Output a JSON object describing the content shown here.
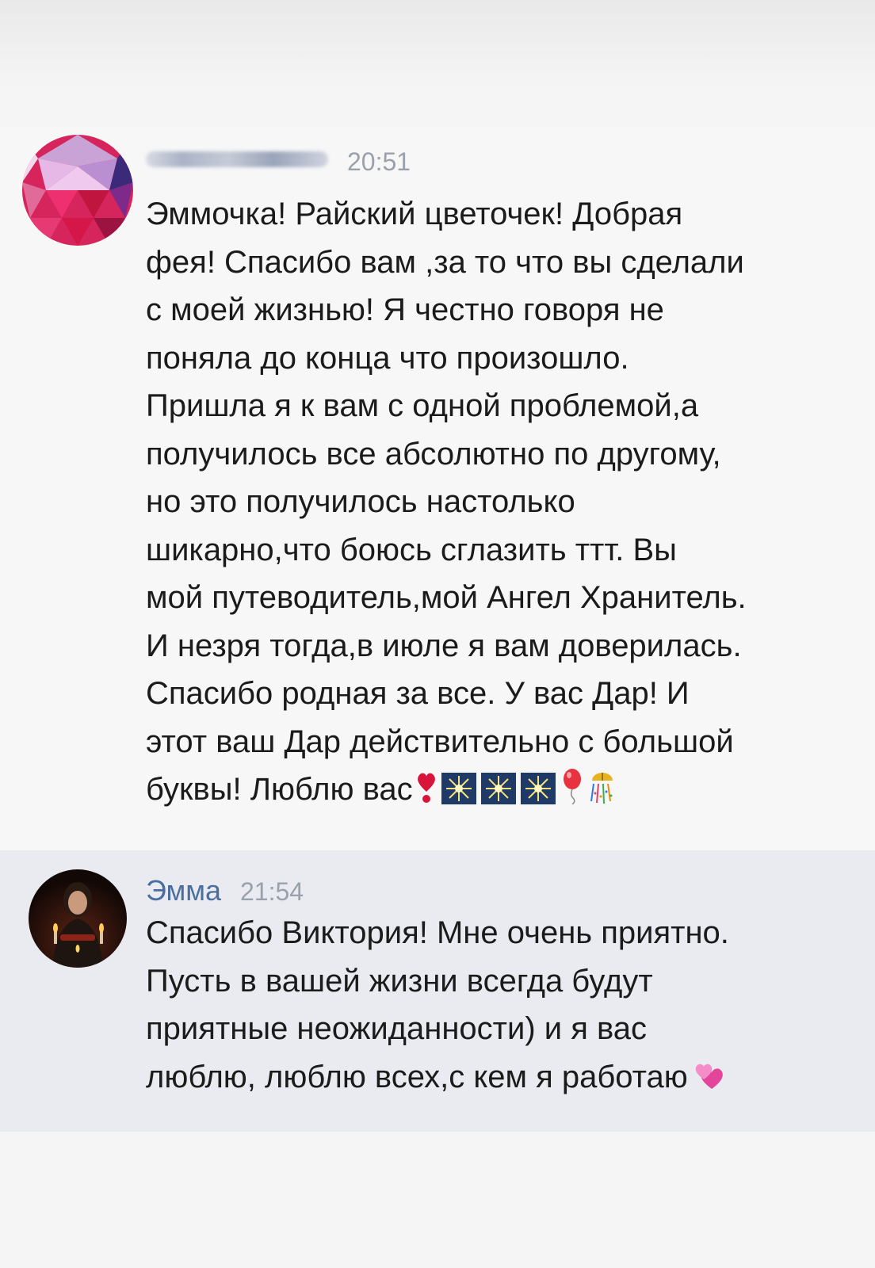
{
  "messages": [
    {
      "author": "",
      "time": "20:51",
      "lines": [
        "Эммочка! Райский цветочек! Добрая",
        "фея! Спасибо вам ,за то что вы сделали",
        "с моей жизнью! Я честно говоря не",
        "поняла до конца что произошло.",
        "Пришла я к вам с одной проблемой,а",
        "получилось все абсолютно по другому,",
        "но это получилось настолько",
        "шикарно,что боюсь сглазить ттт. Вы",
        "мой путеводитель,мой Ангел Хранитель.",
        "И незря тогда,в июле я вам доверилась.",
        "Спасибо родная за все. У вас Дар! И",
        "этот ваш Дар действительно с большой",
        "буквы! Люблю вас"
      ],
      "trailing_emoji": [
        "heart-exclamation",
        "sparkler",
        "sparkler",
        "sparkler",
        "balloon",
        "confetti-ball"
      ]
    },
    {
      "author": "Эмма",
      "time": "21:54",
      "lines": [
        "Спасибо Виктория! Мне очень приятно.",
        "Пусть в вашей жизни всегда будут",
        "приятные неожиданности) и я вас",
        "люблю, люблю всех,с кем я работаю"
      ],
      "trailing_emoji": [
        "two-hearts"
      ]
    }
  ],
  "colors": {
    "author_name": "#4a6f9e",
    "time": "#9aa1ab",
    "reply_background": "#e9ebf0"
  }
}
